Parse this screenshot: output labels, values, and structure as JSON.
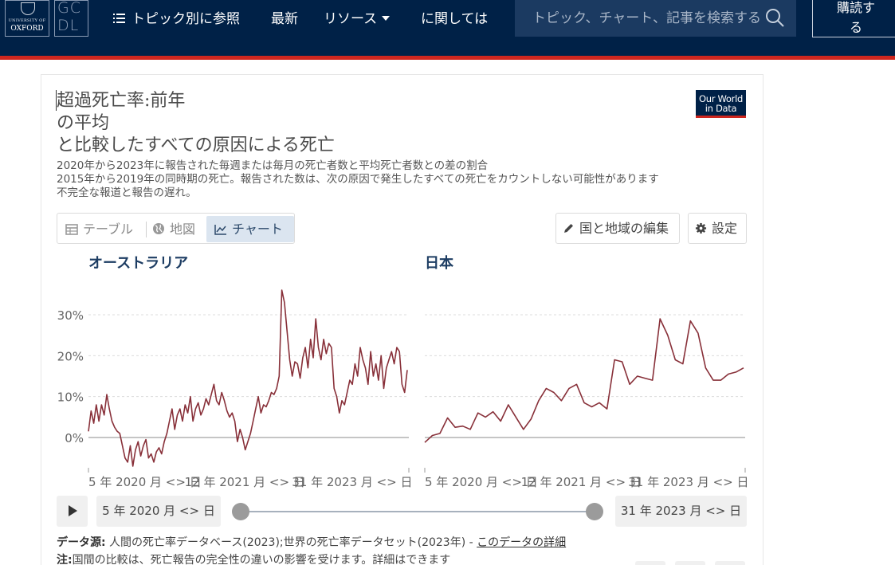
{
  "nav": {
    "oxford_university": "UNIVERSITY OF",
    "oxford_name": "OXFORD",
    "gcdl_top": "GC",
    "gcdl_bottom": "DL",
    "topics": "トピック別に参照",
    "latest": "最新",
    "resources": "リソース",
    "about": "に関しては",
    "search_placeholder": "トピック、チャート、記事を検索する",
    "subscribe": "購読す\nる"
  },
  "chart": {
    "title": "超過死亡率:前年\nの平均\nと比較したすべての原因による死亡",
    "subtitle": "2020年から2023年に報告された毎週または毎月の死亡者数と平均死亡者数との差の割合\n2015年から2019年の同時期の死亡。報告された数は、次の原因で発生したすべての死亡をカウントしない可能性があります\n不完全な報道と報告の遅れ。",
    "logo_line1": "Our World",
    "logo_line2": "in Data",
    "tabs": {
      "table": "テーブル",
      "map": "地図",
      "chart": "チャート"
    },
    "edit_button": "国と地域の編集",
    "settings_button": "設定",
    "time_start": "5 年 2020 月 <> 日",
    "time_end": "31 年 2023 月 <> 日",
    "source_label": "データ源:",
    "source_text": " 人間の死亡率データベース(2023);世界の死亡率データセット(2023年) - ",
    "source_link": "このデータの詳細",
    "note_label": "注:",
    "note_text": "国間の比較は、死亡報告の完全性の違いの影響を受けます。詳細はできます"
  },
  "chart_data": [
    {
      "type": "line",
      "title": "オーストラリア",
      "color": "#883039",
      "y_ticks": [
        "0%",
        "10%",
        "20%",
        "30%"
      ],
      "ylim": [
        -7,
        37
      ],
      "x_tick_labels": [
        "5 年 2020 月 <> 日",
        "12 年 2021 月 <> 日",
        "31 年 2023 月 <> 日"
      ],
      "x_range": [
        "2020-01-05",
        "2023-12-31"
      ],
      "values": [
        1.5,
        6.5,
        3.5,
        8,
        4,
        8,
        5.5,
        10.5,
        7,
        4,
        2.5,
        1.5,
        1,
        -2,
        -5,
        -6,
        -2,
        -7,
        -3,
        -1,
        -4.5,
        -2,
        -0.5,
        -5,
        -4,
        -6,
        -3.5,
        -2.5,
        -4,
        -1,
        1,
        4,
        7,
        2,
        5.5,
        7,
        4,
        8,
        6,
        10,
        4,
        7,
        8.5,
        5.5,
        7,
        9.5,
        8,
        10.5,
        13,
        9,
        8,
        11,
        9,
        6.5,
        5,
        6,
        4,
        -1,
        2,
        0,
        -3,
        -1,
        1,
        4,
        7,
        10,
        6,
        8,
        7.5,
        9,
        11,
        10.5,
        12,
        15,
        36,
        33,
        26,
        19,
        15,
        18.5,
        18,
        14.5,
        19.5,
        22,
        17,
        24,
        19.5,
        29,
        22,
        19,
        24,
        20.5,
        23,
        22,
        12,
        10,
        6,
        9,
        8,
        11,
        14,
        13,
        18,
        15,
        22,
        19,
        17,
        13,
        21,
        15,
        18,
        14,
        20,
        12,
        17,
        19,
        21,
        18,
        22,
        21,
        13,
        11,
        16.5
      ]
    },
    {
      "type": "line",
      "title": "日本",
      "color": "#883039",
      "y_ticks": [
        "0%",
        "10%",
        "20%",
        "30%"
      ],
      "ylim": [
        -7,
        37
      ],
      "x_tick_labels": [
        "5 年 2020 月 <> 日",
        "12 年 2021 月 <> 日",
        "31 年 2023 月 <> 日"
      ],
      "x_range": [
        "2020-01-05",
        "2023-12-31"
      ],
      "values": [
        -1.2,
        0.5,
        1,
        4.8,
        2.5,
        2.8,
        2,
        6,
        5,
        6.3,
        4,
        8,
        5,
        2,
        4.5,
        9,
        12,
        11,
        9,
        12,
        13,
        8.5,
        7.5,
        8.5,
        7,
        19,
        18.5,
        13,
        15,
        14.5,
        14,
        29,
        25,
        19,
        18,
        28.5,
        25.5,
        17,
        14,
        14,
        15.5,
        16,
        17
      ]
    }
  ]
}
